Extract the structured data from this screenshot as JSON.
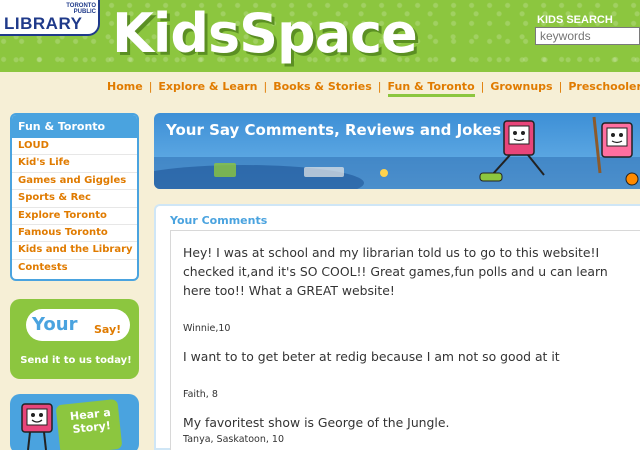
{
  "logo": {
    "top": "TORONTO PUBLIC",
    "main": "LIBRARY"
  },
  "site_title": "KidsSpace",
  "search": {
    "label": "KIDS SEARCH",
    "placeholder": "keywords"
  },
  "nav": {
    "items": [
      "Home",
      "Explore & Learn",
      "Books & Stories",
      "Fun & Toronto",
      "Grownups",
      "Preschoolers"
    ],
    "active": "Fun & Toronto"
  },
  "sidebar": {
    "heading": "Fun & Toronto",
    "items": [
      "LOUD",
      "Kid's Life",
      "Games and Giggles",
      "Sports & Rec",
      "Explore Toronto",
      "Famous Toronto",
      "Kids and the Library",
      "Contests"
    ]
  },
  "promo_say": {
    "your": "Your",
    "say": "Say!",
    "send": "Send it to us today!"
  },
  "promo_story": {
    "line1": "Hear a",
    "line2": "Story!"
  },
  "banner": {
    "title": "Your Say Comments, Reviews and Jokes"
  },
  "comments_section": {
    "heading": "Your Comments",
    "comments": [
      {
        "text": "Hey! I was at school and my librarian told us to go to this website!I checked it,and it's SO COOL!! Great games,fun polls and u can learn here too!! What a GREAT website!",
        "author": "Winnie,10"
      },
      {
        "text": "I want to to get beter at redig because I am not so good at it",
        "author": "Faith, 8"
      },
      {
        "text": "My favoritest show is George of the Jungle.",
        "author": "Tanya, Saskatoon, 10"
      }
    ]
  },
  "colors": {
    "green": "#8cc63f",
    "blue": "#4aa3df",
    "orange": "#e07b00",
    "cream": "#f6efd6",
    "navy": "#1f3a8a"
  }
}
